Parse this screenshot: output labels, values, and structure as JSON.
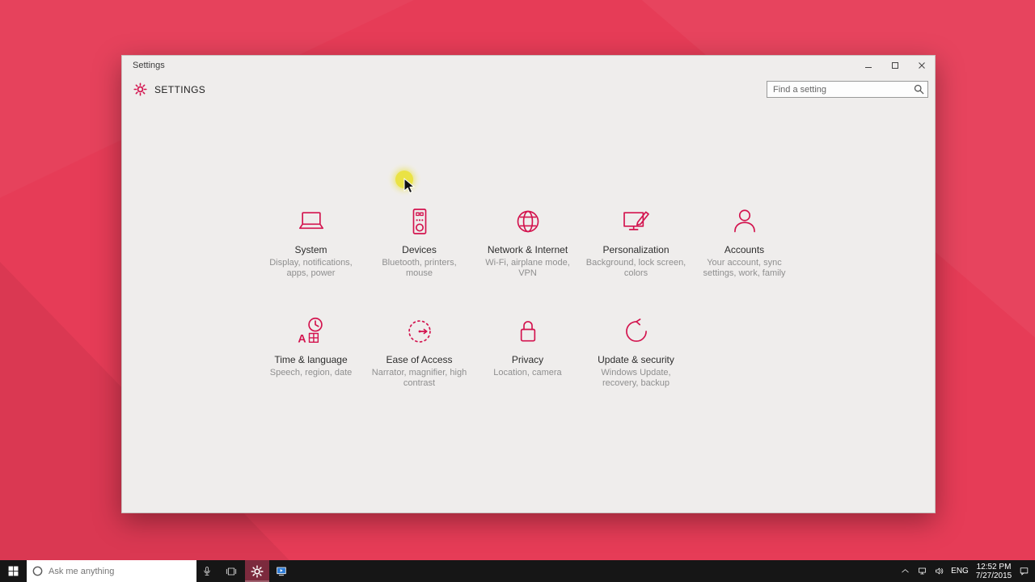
{
  "window": {
    "title": "Settings",
    "controls": {
      "minimize": "minimize",
      "maximize": "maximize",
      "close": "close"
    },
    "header": {
      "app_title": "SETTINGS",
      "search_placeholder": "Find a setting"
    },
    "tiles": [
      {
        "title": "System",
        "subtitle": "Display, notifications, apps, power",
        "icon": "system-laptop-icon"
      },
      {
        "title": "Devices",
        "subtitle": "Bluetooth, printers, mouse",
        "icon": "devices-icon"
      },
      {
        "title": "Network & Internet",
        "subtitle": "Wi-Fi, airplane mode, VPN",
        "icon": "network-globe-icon"
      },
      {
        "title": "Personalization",
        "subtitle": "Background, lock screen, colors",
        "icon": "personalization-icon"
      },
      {
        "title": "Accounts",
        "subtitle": "Your account, sync settings, work, family",
        "icon": "accounts-person-icon"
      },
      {
        "title": "Time & language",
        "subtitle": "Speech, region, date",
        "icon": "time-language-icon"
      },
      {
        "title": "Ease of Access",
        "subtitle": "Narrator, magnifier, high contrast",
        "icon": "ease-of-access-icon"
      },
      {
        "title": "Privacy",
        "subtitle": "Location, camera",
        "icon": "privacy-lock-icon"
      },
      {
        "title": "Update & security",
        "subtitle": "Windows Update, recovery, backup",
        "icon": "update-security-icon"
      }
    ]
  },
  "taskbar": {
    "search_placeholder": "Ask me anything",
    "tray": {
      "language": "ENG",
      "time": "12:52 PM",
      "date": "7/27/2015"
    }
  },
  "colors": {
    "accent": "#d3134e",
    "desktop_bg": "#e63c57",
    "window_bg": "#efedec",
    "taskbar_bg": "#161616"
  },
  "icons": {
    "app_gear": "gear-icon",
    "search": "magnifier-icon",
    "start": "windows-logo-icon",
    "cortana": "cortana-circle-icon",
    "microphone": "microphone-icon",
    "task_view": "task-view-icon",
    "settings_app": "gear-icon",
    "movies_tv": "movies-tv-icon",
    "chevron_up": "chevron-up-icon",
    "network": "network-icon",
    "volume": "volume-icon",
    "action_center": "action-center-icon",
    "click_highlight": "click-highlight-dot",
    "cursor": "mouse-cursor"
  }
}
